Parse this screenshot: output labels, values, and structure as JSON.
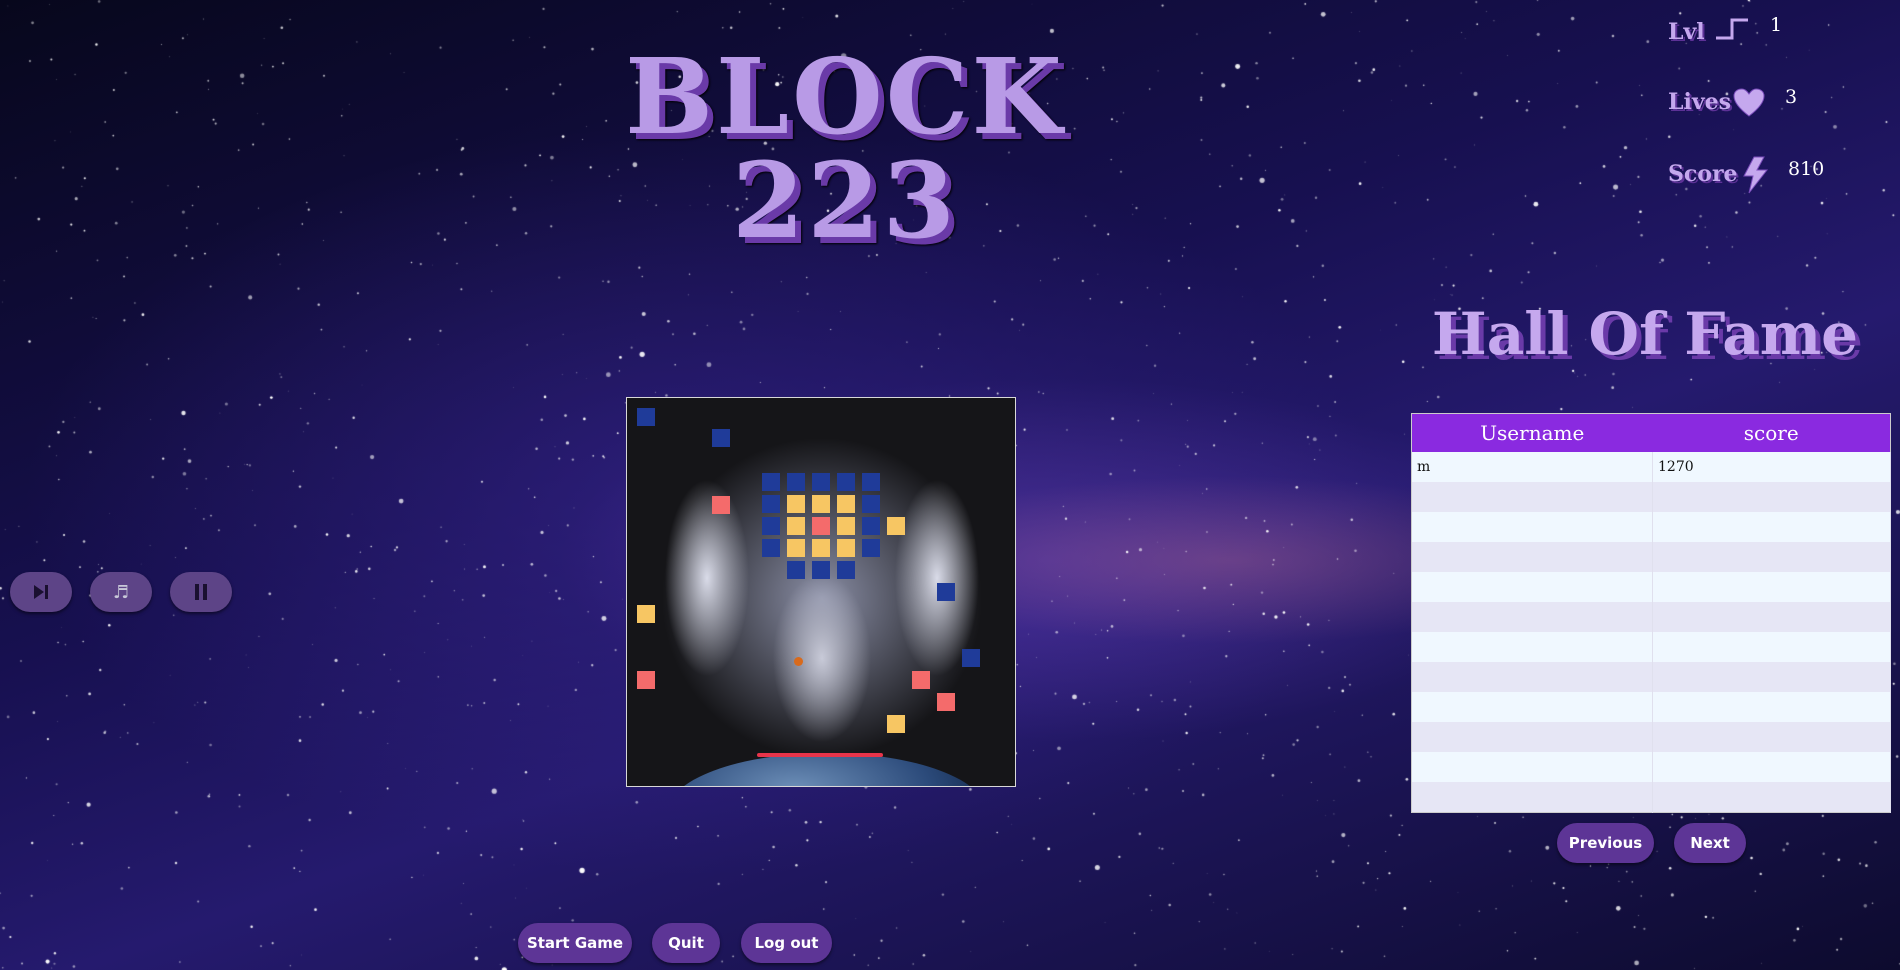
{
  "title": "BLOCK 223",
  "stats": {
    "level_label": "Lvl",
    "level_value": "1",
    "lives_label": "Lives",
    "lives_value": "3",
    "score_label": "Score",
    "score_value": "810"
  },
  "controls": {
    "skip_icon": "skip-forward-icon",
    "music_icon": "music-note-icon",
    "pause_icon": "pause-icon"
  },
  "hall_of_fame": {
    "title": "Hall Of Fame",
    "columns": [
      "Username",
      "score"
    ],
    "rows": [
      {
        "username": "m",
        "score": "1270"
      },
      {
        "username": "",
        "score": ""
      },
      {
        "username": "",
        "score": ""
      },
      {
        "username": "",
        "score": ""
      },
      {
        "username": "",
        "score": ""
      },
      {
        "username": "",
        "score": ""
      },
      {
        "username": "",
        "score": ""
      },
      {
        "username": "",
        "score": ""
      },
      {
        "username": "",
        "score": ""
      },
      {
        "username": "",
        "score": ""
      },
      {
        "username": "",
        "score": ""
      },
      {
        "username": "",
        "score": ""
      }
    ],
    "previous_label": "Previous",
    "next_label": "Next"
  },
  "buttons": {
    "start_label": "Start Game",
    "quit_label": "Quit",
    "logout_label": "Log out"
  },
  "colors": {
    "block_blue": "#1f3b99",
    "block_yellow": "#f7c663",
    "block_red": "#f46b6b",
    "header_purple": "#8a2ae0",
    "button_purple": "#5d3596"
  }
}
